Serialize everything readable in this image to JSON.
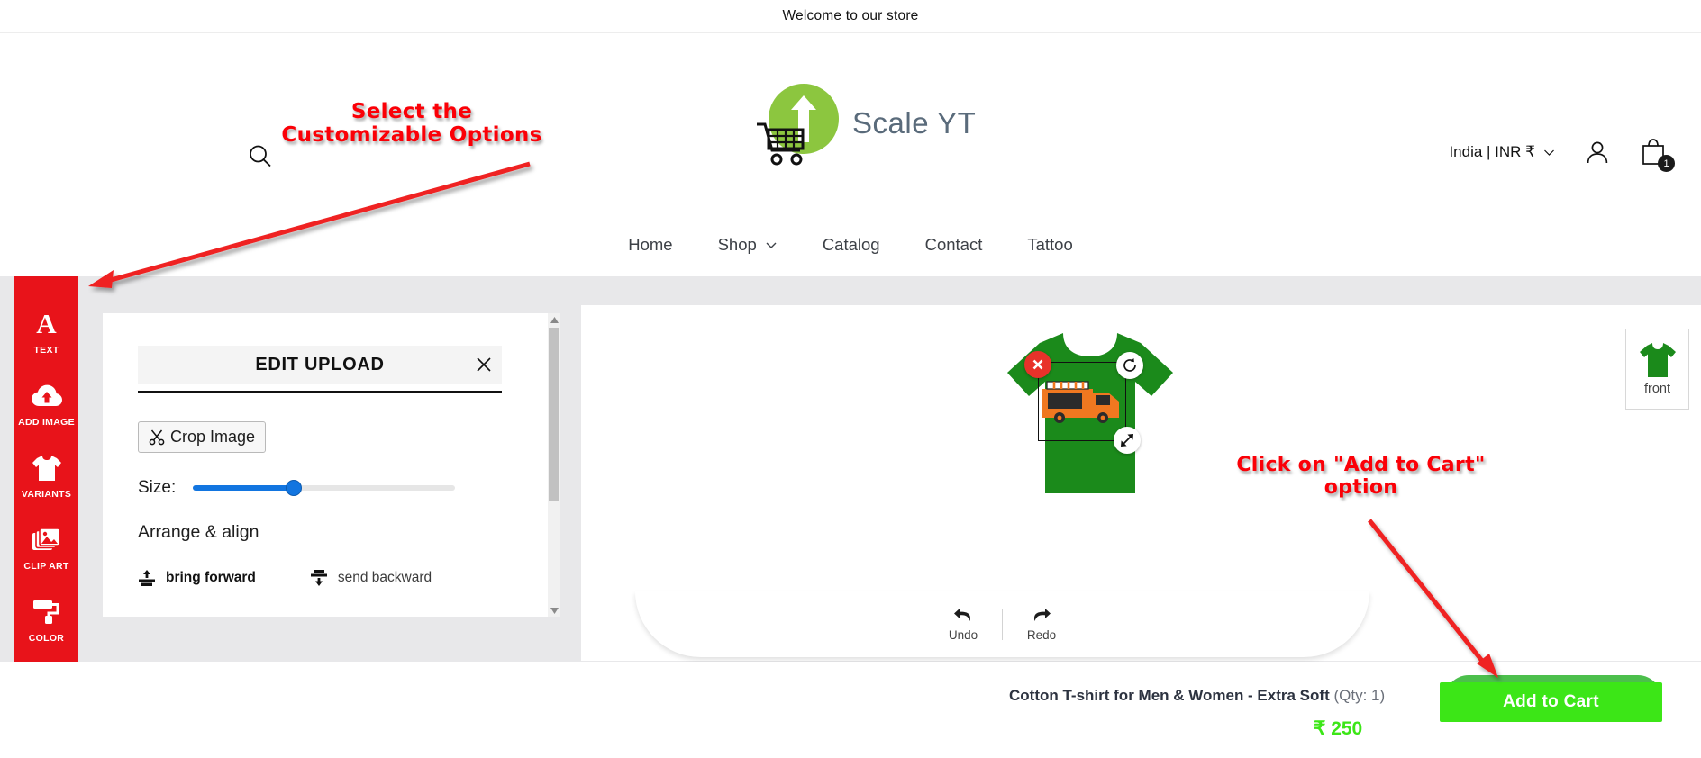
{
  "announcement": {
    "text": "Welcome to our store"
  },
  "header": {
    "logo_text": "Scale YT",
    "logo_icon": "green-circle-up-arrow-cart-logo",
    "search_icon": "search-icon",
    "locale": {
      "label": "India | INR ₹",
      "chevron_icon": "chevron-down-icon"
    },
    "account_icon": "person-icon",
    "cart": {
      "icon": "shopping-bag-icon",
      "count": "1"
    }
  },
  "nav": {
    "items": [
      {
        "label": "Home",
        "has_chevron": false
      },
      {
        "label": "Shop",
        "has_chevron": true
      },
      {
        "label": "Catalog",
        "has_chevron": false
      },
      {
        "label": "Contact",
        "has_chevron": false
      },
      {
        "label": "Tattoo",
        "has_chevron": false
      }
    ]
  },
  "sidebar": {
    "items": [
      {
        "label": "TEXT",
        "icon": "letter-a-icon"
      },
      {
        "label": "ADD IMAGE",
        "icon": "cloud-upload-icon"
      },
      {
        "label": "VARIANTS",
        "icon": "tshirt-icon"
      },
      {
        "label": "CLIP ART",
        "icon": "images-stack-icon"
      },
      {
        "label": "COLOR",
        "icon": "paint-roller-icon"
      }
    ],
    "background_color": "#e8131a"
  },
  "edit_panel": {
    "title": "EDIT UPLOAD",
    "close_icon": "close-icon",
    "crop_button": {
      "label": "Crop Image",
      "icon": "scissors-icon"
    },
    "size": {
      "label": "Size:",
      "value_percent": 39,
      "fill_color": "#1275e0"
    },
    "arrange": {
      "title": "Arrange & align",
      "actions": [
        {
          "label": "bring forward",
          "icon": "bring-forward-icon"
        },
        {
          "label": "send backward",
          "icon": "send-backward-icon"
        }
      ]
    },
    "scrollbar": {
      "up_icon": "caret-up-icon",
      "down_icon": "caret-down-icon"
    }
  },
  "canvas": {
    "product_color": "#1b8a1b",
    "artwork_icon": "food-truck-clipart",
    "handles": [
      {
        "name": "delete-handle",
        "icon": "close-x-icon"
      },
      {
        "name": "rotate-handle",
        "icon": "rotate-icon"
      },
      {
        "name": "resize-handle",
        "icon": "resize-diagonal-icon"
      }
    ],
    "undo": {
      "label": "Undo",
      "icon": "undo-arrow-icon"
    },
    "redo": {
      "label": "Redo",
      "icon": "redo-arrow-icon"
    },
    "view_thumb": {
      "label": "front",
      "icon": "tshirt-icon"
    }
  },
  "bottom_bar": {
    "product_name": "Cotton T-shirt for Men & Women - Extra Soft",
    "qty_text": "(Qty: 1)",
    "price": "₹ 250",
    "price_color": "#3ce617",
    "add_to_cart_label": "Add to Cart"
  },
  "annotations": [
    {
      "text": "Select the\nCustomizable Options",
      "color": "#fb0007"
    },
    {
      "text": "Click on \"Add to Cart\"\noption",
      "color": "#fb0007"
    }
  ]
}
